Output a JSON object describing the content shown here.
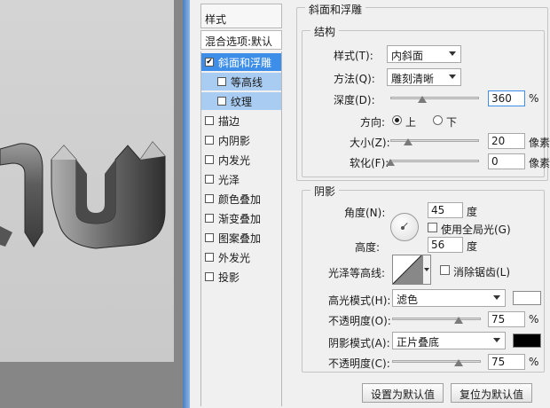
{
  "canvas": {
    "preview_text": "nu"
  },
  "styles_panel": {
    "title": "样式",
    "blend_options": "混合选项:默认",
    "items": [
      {
        "label": "斜面和浮雕",
        "checked": true,
        "active": true,
        "sub": false
      },
      {
        "label": "等高线",
        "checked": false,
        "active": false,
        "sub": true
      },
      {
        "label": "纹理",
        "checked": false,
        "active": false,
        "sub": true
      },
      {
        "label": "描边",
        "checked": false,
        "active": false,
        "sub": false
      },
      {
        "label": "内阴影",
        "checked": false,
        "active": false,
        "sub": false
      },
      {
        "label": "内发光",
        "checked": false,
        "active": false,
        "sub": false
      },
      {
        "label": "光泽",
        "checked": false,
        "active": false,
        "sub": false
      },
      {
        "label": "颜色叠加",
        "checked": false,
        "active": false,
        "sub": false
      },
      {
        "label": "渐变叠加",
        "checked": false,
        "active": false,
        "sub": false
      },
      {
        "label": "图案叠加",
        "checked": false,
        "active": false,
        "sub": false
      },
      {
        "label": "外发光",
        "checked": false,
        "active": false,
        "sub": false
      },
      {
        "label": "投影",
        "checked": false,
        "active": false,
        "sub": false
      }
    ]
  },
  "bevel": {
    "section_title": "斜面和浮雕",
    "structure": {
      "title": "结构",
      "style_label": "样式(T):",
      "style_value": "内斜面",
      "technique_label": "方法(Q):",
      "technique_value": "雕刻清晰",
      "depth_label": "深度(D):",
      "depth_value": "360",
      "depth_unit": "%",
      "depth_slider": 0.36,
      "direction_label": "方向:",
      "direction_up": "上",
      "direction_down": "下",
      "direction_selected": "上",
      "size_label": "大小(Z):",
      "size_value": "20",
      "size_unit": "像素",
      "size_slider": 0.2,
      "soften_label": "软化(F):",
      "soften_value": "0",
      "soften_unit": "像素",
      "soften_slider": 0.0
    },
    "shading": {
      "title": "阴影",
      "angle_label": "角度(N):",
      "angle_value": "45",
      "angle_unit": "度",
      "global_light_label": "使用全局光(G)",
      "global_light_checked": false,
      "altitude_label": "高度:",
      "altitude_value": "56",
      "altitude_unit": "度",
      "gloss_contour_label": "光泽等高线:",
      "anti_alias_label": "消除锯齿(L)",
      "anti_alias_checked": false,
      "highlight_mode_label": "高光模式(H):",
      "highlight_mode_value": "滤色",
      "highlight_color": "#ffffff",
      "highlight_opacity_label": "不透明度(O):",
      "highlight_opacity_value": "75",
      "highlight_opacity_unit": "%",
      "highlight_opacity_slider": 0.75,
      "shadow_mode_label": "阴影模式(A):",
      "shadow_mode_value": "正片叠底",
      "shadow_color": "#000000",
      "shadow_opacity_label": "不透明度(C):",
      "shadow_opacity_value": "75",
      "shadow_opacity_unit": "%",
      "shadow_opacity_slider": 0.75
    },
    "buttons": {
      "make_default": "设置为默认值",
      "reset_default": "复位为默认值"
    }
  }
}
